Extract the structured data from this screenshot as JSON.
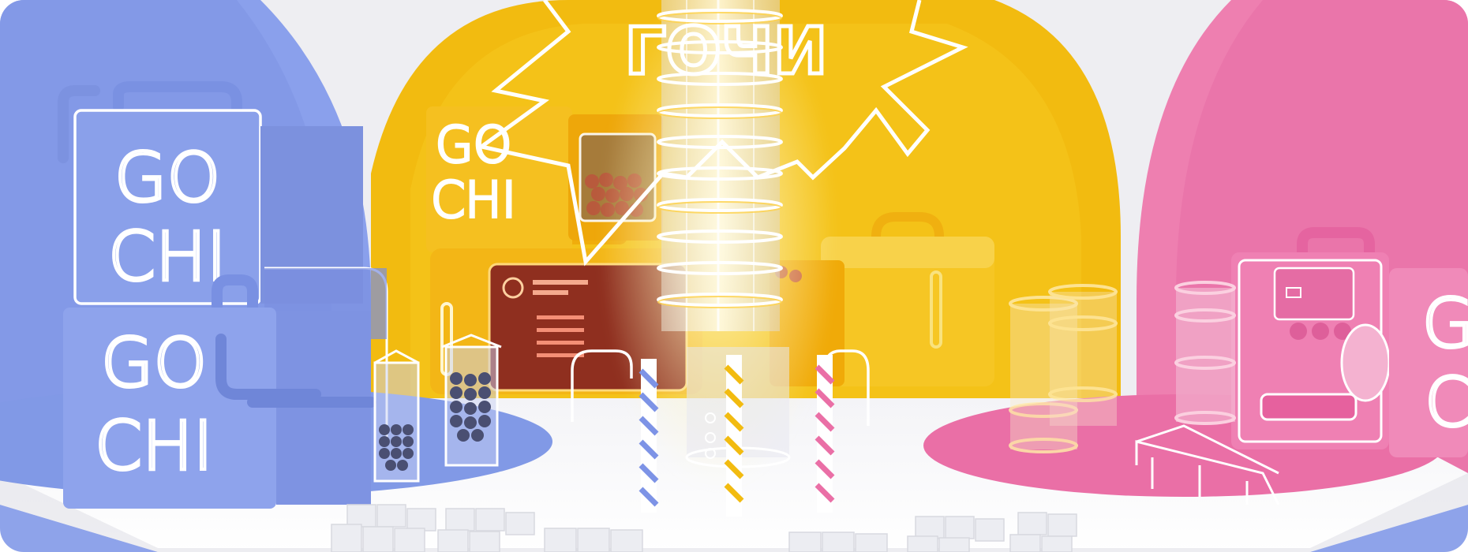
{
  "scene": {
    "speech_bubble_text": "ГОЧИ",
    "left_box_top_line1": "GO",
    "left_box_top_line2": "CHI",
    "left_box_bottom_line1": "GO",
    "left_box_bottom_line2": "CHI",
    "back_box_line1": "GO",
    "back_box_line2": "CHI",
    "right_box_partial_line1": "G",
    "right_box_partial_line2": "C",
    "colors": {
      "blue": "#8199e6",
      "yellow": "#f1b80c",
      "pink": "#ea6fa6",
      "floor": "#f6f6f8",
      "neon": "#ffffff"
    }
  }
}
